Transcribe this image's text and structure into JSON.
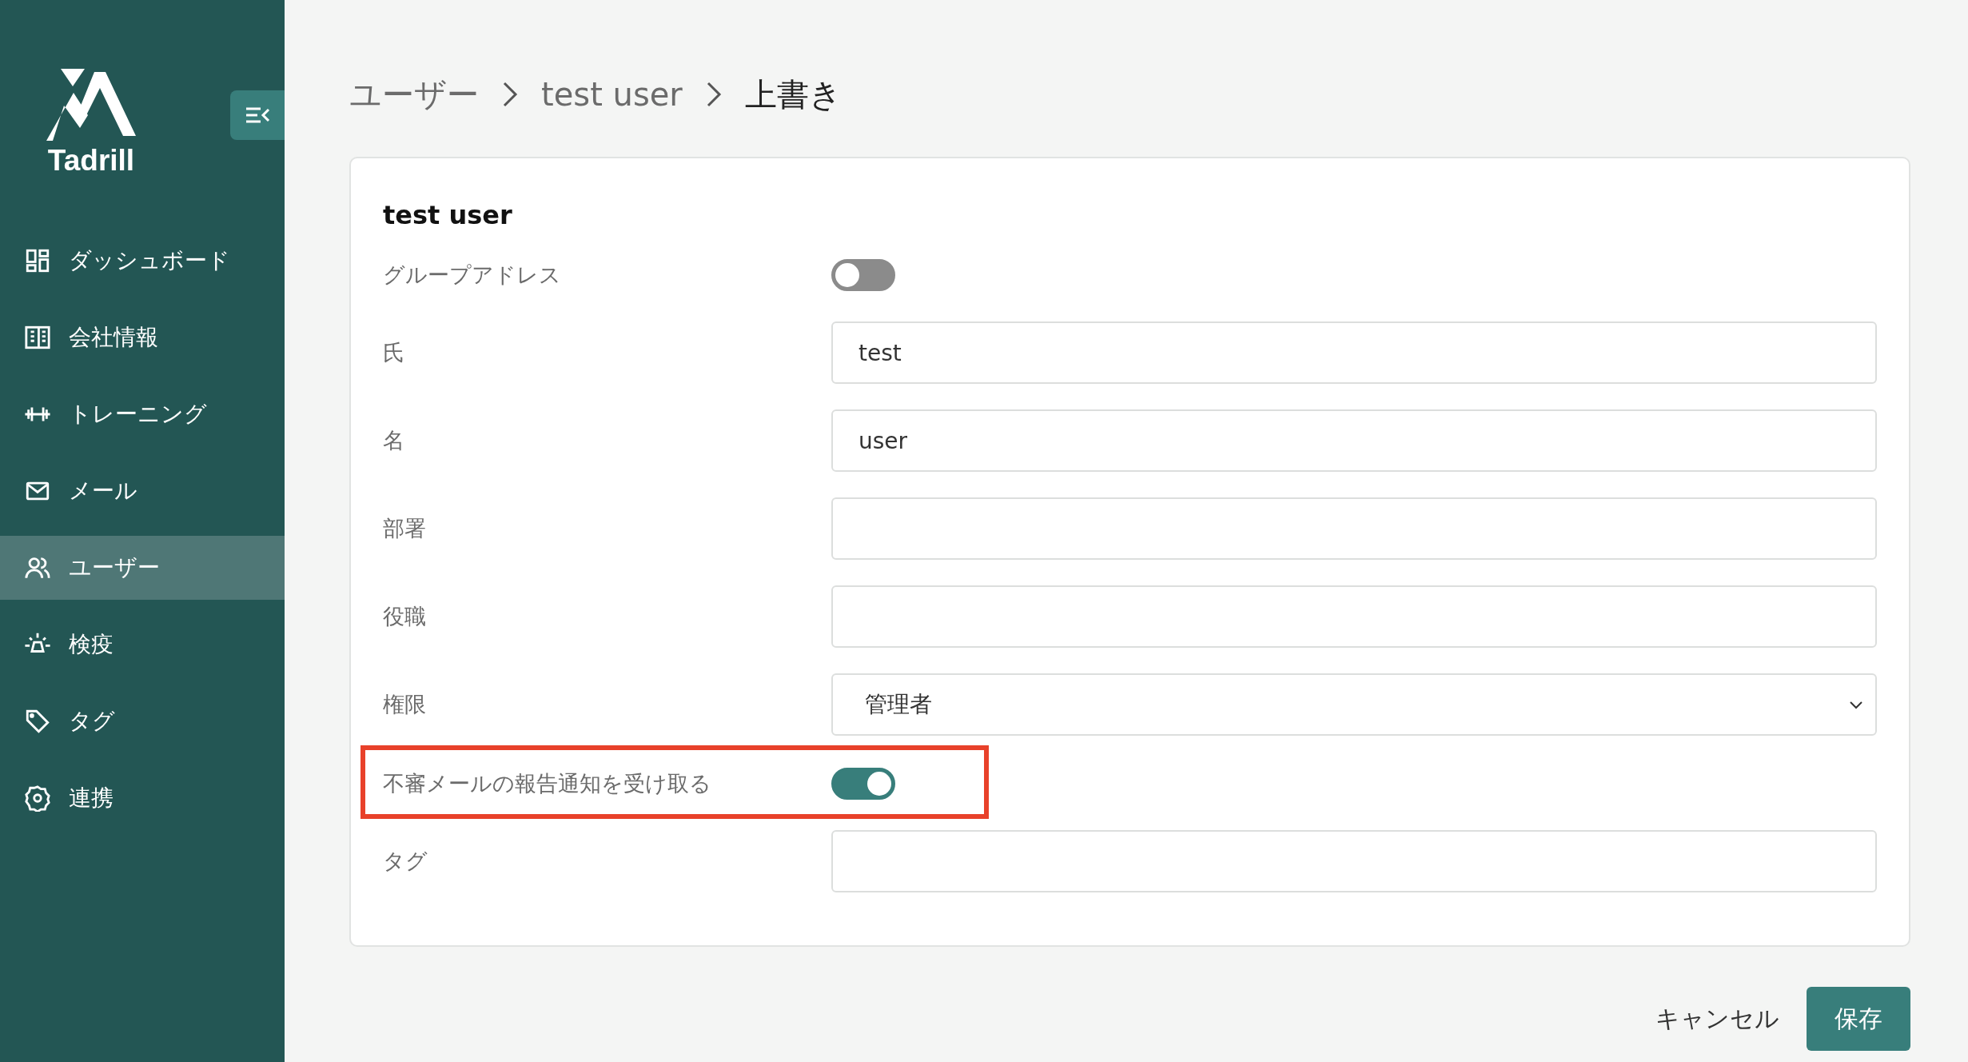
{
  "sidebar": {
    "logo": {
      "text": "Tadrill"
    },
    "items": [
      {
        "label": "ダッシュボード",
        "selected": false
      },
      {
        "label": "会社情報",
        "selected": false
      },
      {
        "label": "トレーニング",
        "selected": false
      },
      {
        "label": "メール",
        "selected": false
      },
      {
        "label": "ユーザー",
        "selected": true
      },
      {
        "label": "検疫",
        "selected": false
      },
      {
        "label": "タグ",
        "selected": false
      },
      {
        "label": "連携",
        "selected": false
      }
    ]
  },
  "breadcrumb": [
    {
      "label": "ユーザー",
      "current": false
    },
    {
      "label": "test user",
      "current": false
    },
    {
      "label": "上書き",
      "current": true
    }
  ],
  "card": {
    "title": "test user",
    "fields": [
      {
        "kind": "toggle",
        "label": "グループアドレス",
        "on": false,
        "highlighted": false
      },
      {
        "kind": "text",
        "label": "氏",
        "value": "test"
      },
      {
        "kind": "text",
        "label": "名",
        "value": "user"
      },
      {
        "kind": "text",
        "label": "部署"
      },
      {
        "kind": "text",
        "label": "役職"
      },
      {
        "kind": "select",
        "label": "権限",
        "value": "管理者"
      },
      {
        "kind": "toggle",
        "label": "不審メールの報告通知を受け取る",
        "on": true,
        "highlighted": true
      },
      {
        "kind": "text",
        "label": "タグ"
      }
    ]
  },
  "buttons": [
    {
      "kind": "secondary",
      "label": "キャンセル"
    },
    {
      "kind": "primary",
      "label": "保存"
    }
  ]
}
